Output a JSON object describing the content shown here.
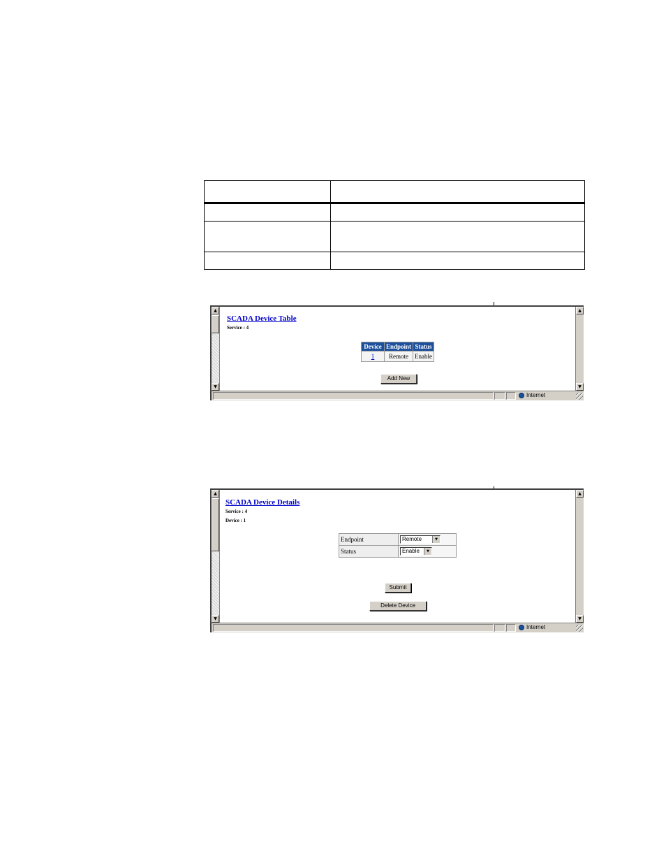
{
  "browser": {
    "zone_label": "Internet",
    "scroll_up_glyph": "▲",
    "scroll_down_glyph": "▼"
  },
  "device_table_page": {
    "title": "SCADA Device Table",
    "service_label": "Service : 4",
    "columns": [
      "Device",
      "Endpoint",
      "Status"
    ],
    "rows": [
      {
        "device": "1",
        "endpoint": "Remote",
        "status": "Enable"
      }
    ],
    "add_new_label": "Add New"
  },
  "device_details_page": {
    "title": "SCADA Device Details",
    "service_label": "Service : 4",
    "device_label": "Device : 1",
    "fields": [
      {
        "label": "Endpoint",
        "value": "Remote"
      },
      {
        "label": "Status",
        "value": "Enable"
      }
    ],
    "dropdown_glyph": "▼",
    "submit_label": "Submit",
    "delete_label": "Delete Device"
  }
}
